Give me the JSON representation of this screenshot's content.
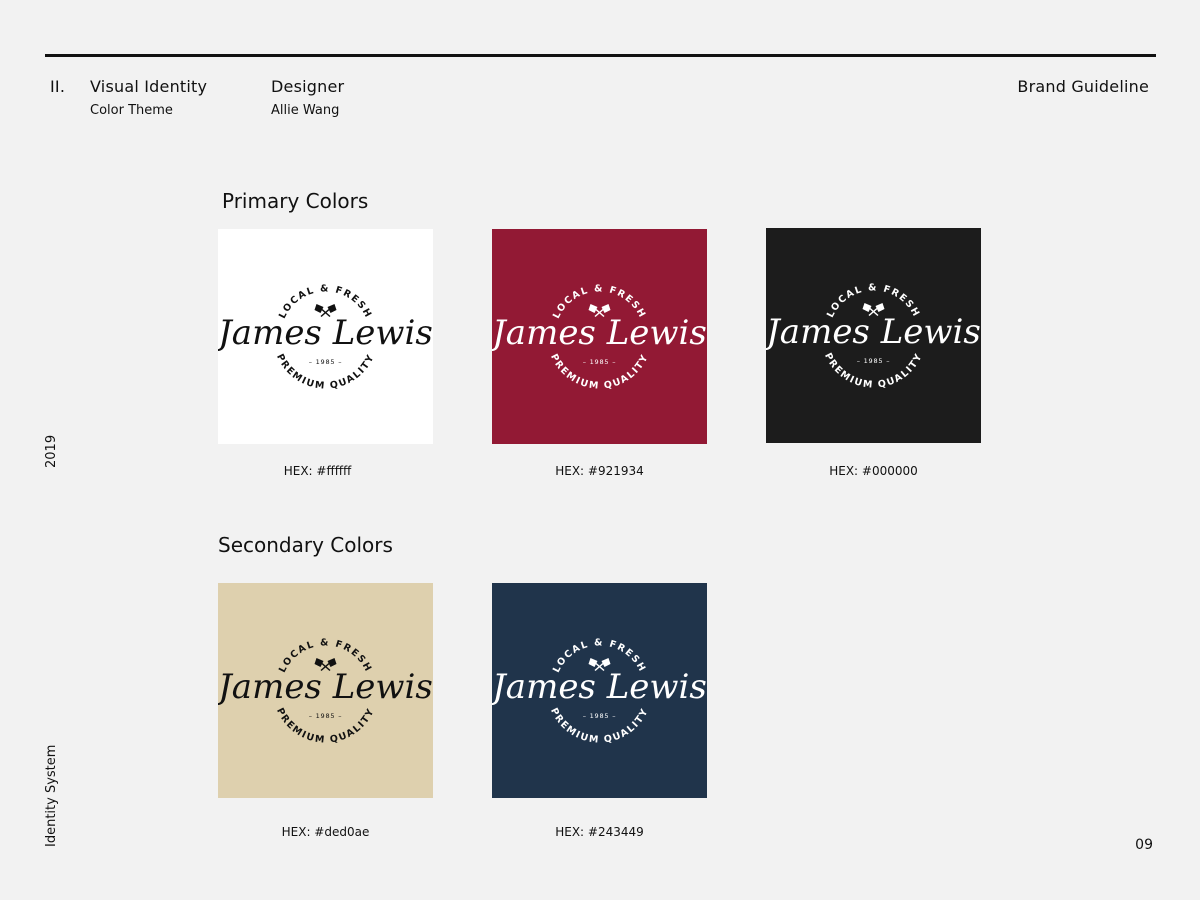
{
  "header": {
    "section_number": "II.",
    "section_title": "Visual Identity",
    "section_subtitle": "Color Theme",
    "designer_label": "Designer",
    "designer_name": "Allie Wang",
    "doc_title": "Brand Guideline"
  },
  "sidebar": {
    "year": "2019",
    "system": "Identity System"
  },
  "page_number": "09",
  "logo": {
    "top_arc": "LOCAL & FRESH",
    "name": "James Lewis",
    "year": "– 1985 –",
    "bottom_arc": "PREMIUM QUALITY",
    "icon": "cleaver-knives-icon"
  },
  "primary": {
    "heading": "Primary Colors",
    "swatches": [
      {
        "hex_label": "HEX: #ffffff",
        "color": "#ffffff",
        "logo_color": "#111111"
      },
      {
        "hex_label": "HEX: #921934",
        "color": "#921934",
        "logo_color": "#ffffff"
      },
      {
        "hex_label": "HEX: #000000",
        "color": "#1c1c1c",
        "logo_color": "#ffffff"
      }
    ]
  },
  "secondary": {
    "heading": "Secondary Colors",
    "swatches": [
      {
        "hex_label": "HEX: #ded0ae",
        "color": "#ded0ae",
        "logo_color": "#111111"
      },
      {
        "hex_label": "HEX: #243449",
        "color": "#20344b",
        "logo_color": "#ffffff"
      }
    ]
  }
}
